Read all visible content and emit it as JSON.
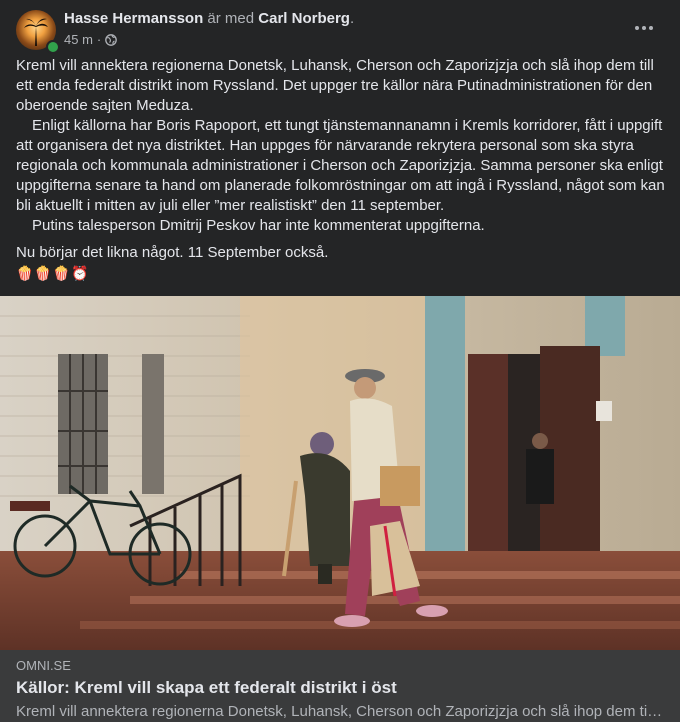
{
  "post": {
    "author": "Hasse Hermansson",
    "with_text": "är med",
    "tagged": "Carl Norberg",
    "tagged_suffix": ".",
    "time": "45 m",
    "separator": "·",
    "audience_icon": "globe-icon",
    "paragraphs": [
      "Kreml vill annektera regionerna Donetsk, Luhansk, Cherson och Zaporizjzja och slå ihop dem till ett enda federalt distrikt inom Ryssland. Det uppger tre källor nära Putinadministrationen för den oberoende sajten Meduza.",
      "Enligt källorna har Boris Rapoport, ett tungt tjänstemannanamn i Kremls korridorer, fått i uppgift att organisera det nya distriktet. Han uppges för närvarande rekrytera personal som ska styra regionala och kommunala administrationer i Cherson och Zaporizjzja. Samma personer ska enligt uppgifterna senare ta hand om planerade folkomröstningar om att ingå i Ryssland, något som kan bli aktuellt i mitten av juli eller ”mer realistiskt” den 11 september.",
      "Putins talesperson Dmitrij Peskov har inte kommenterat uppgifterna."
    ],
    "comment": "Nu börjar det likna något. 11 September också.",
    "emojis": "🍿🍿🍿⏰"
  },
  "link": {
    "domain": "OMNI.SE",
    "title": "Källor: Kreml vill skapa ett federalt distrikt i öst",
    "description": "Kreml vill annektera regionerna Donetsk, Luhansk, Cherson och Zaporizjzja och slå ihop dem till ett enda federalt distrikt inom Ryssland."
  },
  "colors": {
    "background": "#242526",
    "link_box": "#3a3b3c",
    "online": "#31a24c"
  }
}
